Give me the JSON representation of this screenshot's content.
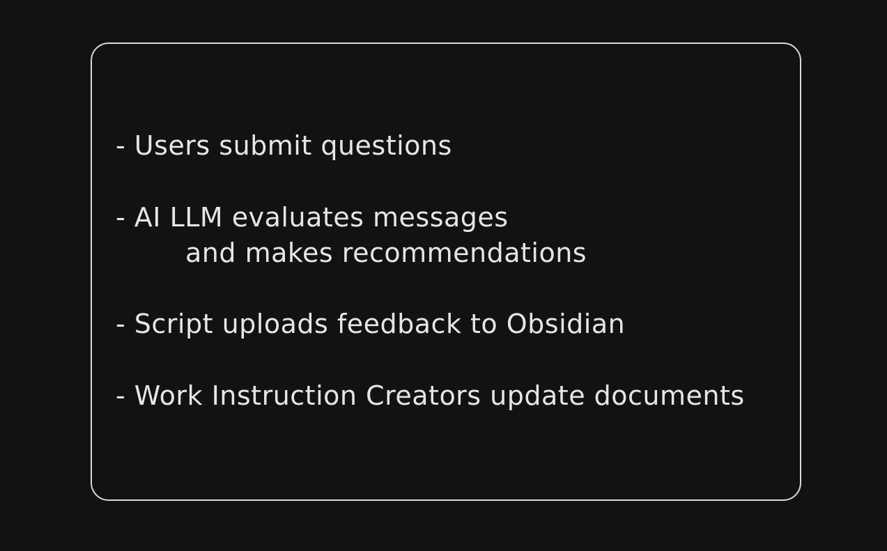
{
  "items": [
    {
      "text": "- Users submit questions"
    },
    {
      "text": "- AI LLM evaluates messages"
    },
    {
      "text": "and makes recommendations"
    },
    {
      "text": "- Script uploads feedback to Obsidian"
    },
    {
      "text": "- Work Instruction Creators update documents"
    }
  ],
  "colors": {
    "background": "#121212",
    "border": "#d9d9d9",
    "text": "#e6e6e6"
  }
}
